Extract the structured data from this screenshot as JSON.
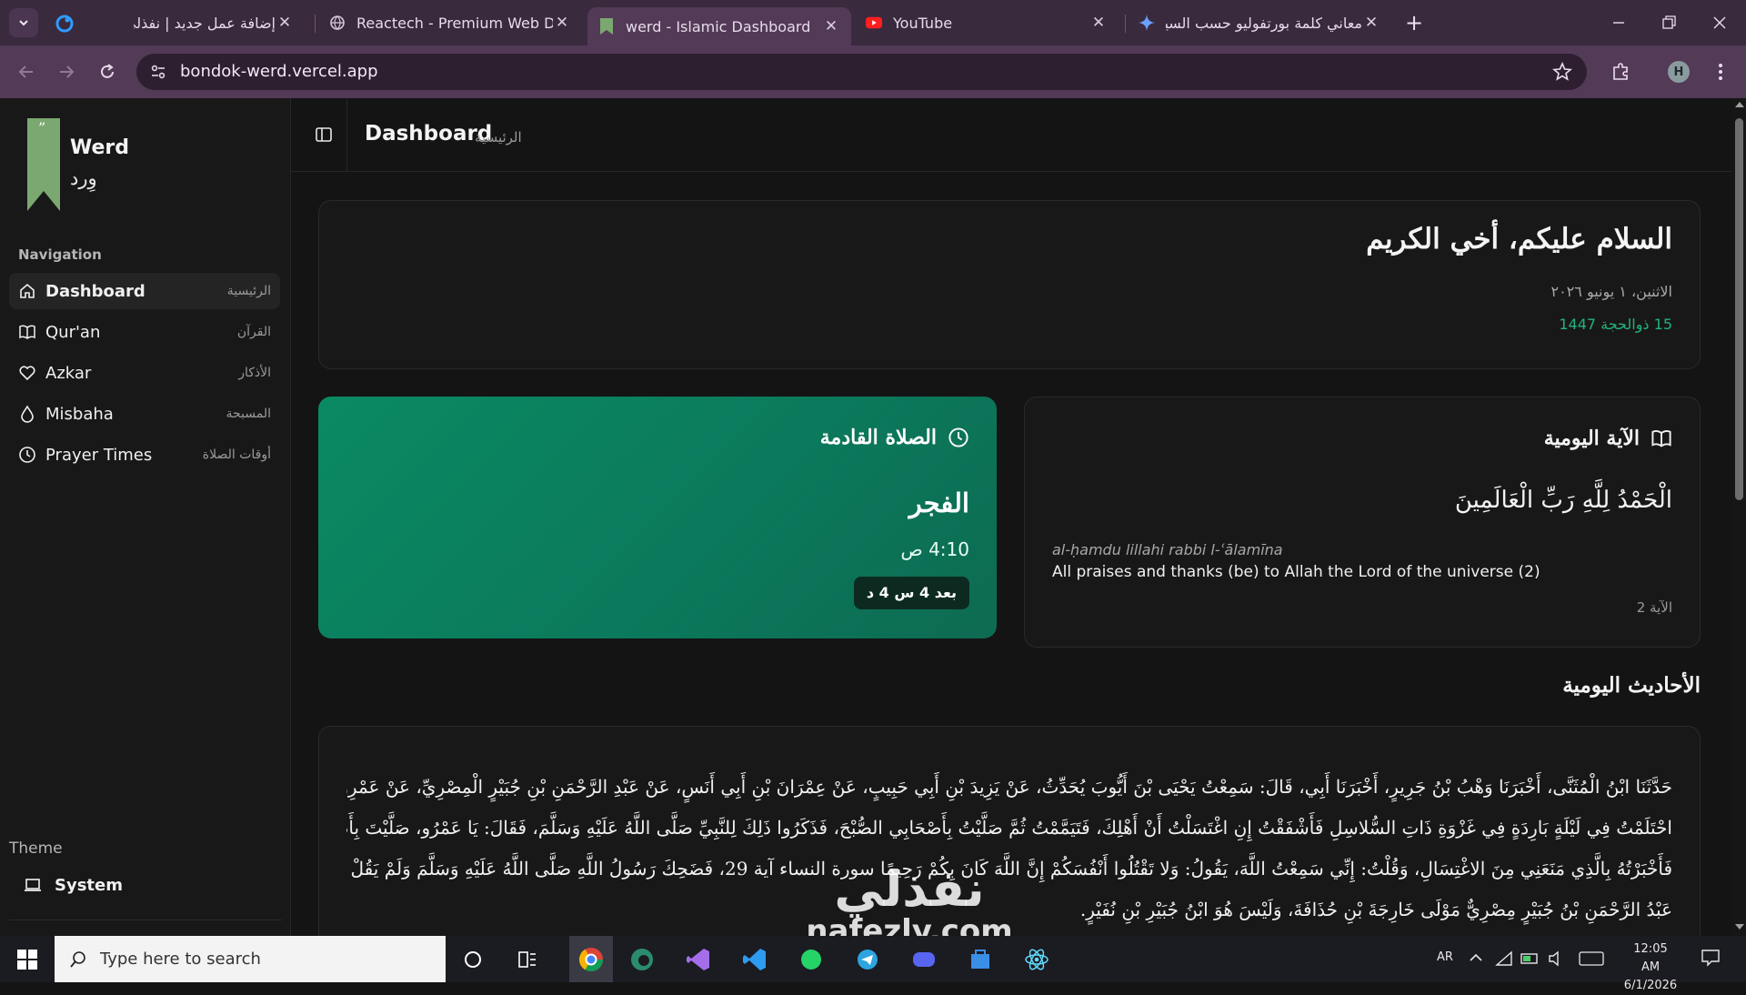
{
  "browser": {
    "tabs": [
      {
        "title": "إضافة عمل جديد | نفذلي"
      },
      {
        "title": "Reactech - Premium Web Devel"
      },
      {
        "title": "werd - Islamic Dashboard"
      },
      {
        "title": "YouTube"
      },
      {
        "title": "معاني كلمة بورتفوليو حسب السيا"
      }
    ],
    "url": "bondok-werd.vercel.app",
    "profile_initial": "H"
  },
  "app": {
    "brand_en": "Werd",
    "brand_ar": "وِرد",
    "nav_heading": "Navigation",
    "nav": [
      {
        "en": "Dashboard",
        "ar": "الرئيسية"
      },
      {
        "en": "Qur'an",
        "ar": "القرآن"
      },
      {
        "en": "Azkar",
        "ar": "الأذكار"
      },
      {
        "en": "Misbaha",
        "ar": "المسبحة"
      },
      {
        "en": "Prayer Times",
        "ar": "أوقات الصلاة"
      }
    ],
    "theme_heading": "Theme",
    "theme_value": "System",
    "header_title": "Dashboard",
    "header_subtitle": "الرئيسية"
  },
  "greeting": {
    "title": "السلام عليكم، أخي الكريم",
    "gregorian": "الاثنين، ١ يونيو ٢٠٢٦",
    "hijri": "15 ذوالحجة 1447"
  },
  "prayer": {
    "heading": "الصلاة القادمة",
    "name": "الفجر",
    "time": "4:10 ص",
    "countdown": "بعد 4 س 4 د"
  },
  "ayah": {
    "heading": "الآية اليومية",
    "arabic": "الْحَمْدُ لِلَّهِ رَبِّ الْعَالَمِينَ",
    "transliteration": "al-ḥamdu lillahi rabbi l-ʿālamīna",
    "translation": "All praises and thanks (be) to Allah the Lord of the universe (2)",
    "number_label": "الآية 2"
  },
  "hadith": {
    "heading": "الأحاديث اليومية",
    "lines": [
      "حَدَّثَنَا ابْنُ الْمُثَنَّى، أَخْبَرَنَا وَهْبُ بْنُ جَرِيرٍ، أَخْبَرَنَا أَبِي، قَالَ: سَمِعْتُ يَحْيَى بْنَ أَيُّوبَ يُحَدِّثُ، عَنْ يَزِيدَ بْنِ أَبِي حَبِيبٍ، عَنْ عِمْرَانَ بْنِ أَبِي أَنَسٍ، عَنْ عَبْدِ الرَّحْمَنِ بْنِ جُبَيْرٍ الْمِصْرِيِّ، عَنْ عَمْرِو بْنِ الْعَاصِ، قَالَ:",
      "احْتَلَمْتُ فِي لَيْلَةٍ بَارِدَةٍ فِي غَزْوَةِ ذَاتِ السُّلاسِلِ فَأَشْفَقْتُ إِنِ اغْتَسَلْتُ أَنْ أَهْلِكَ، فَتَيَمَّمْتُ ثُمَّ صَلَّيْتُ بِأَصْحَابِي الصُّبْحَ، فَذَكَرُوا ذَلِكَ لِلنَّبِيِّ صَلَّى اللَّهُ عَلَيْهِ وَسَلَّمَ، فَقَالَ: يَا عَمْرُو، صَلَّيْتَ بِأَصْحَابِكَ وَأَنْتَ جُنُبٌ ؟",
      "فَأَخْبَرْتُهُ بِالَّذِي مَنَعَنِي مِنَ الاغْتِسَالِ، وَقُلْتُ: إِنِّي سَمِعْتُ اللَّهَ، يَقُولُ: وَلا تَقْتُلُوا أَنْفُسَكُمْ إِنَّ اللَّهَ كَانَ بِكُمْ رَحِيمًا سورة النساء آية 29، فَضَحِكَ رَسُولُ اللَّهِ صَلَّى اللَّهُ عَلَيْهِ وَسَلَّمَ وَلَمْ يَقُلْ شَيْئًا ، قَالَ أَبُو دَاوُد:",
      "عَبْدُ الرَّحْمَنِ بْنُ جُبَيْرٍ مِصْرِيٌّ مَوْلَى خَارِجَةَ بْنِ حُذَافَةَ، وَلَيْسَ هُوَ ابْنُ جُبَيْرِ بْنِ نُفَيْرٍ."
    ]
  },
  "watermark": "nafezly.com",
  "watermark_ar": "نفذلي",
  "taskbar": {
    "search_placeholder": "Type here to search",
    "lang": "AR",
    "time": "12:05 AM",
    "date": "6/1/2026"
  },
  "colors": {
    "accent_green": "#0a8a62",
    "hijri_green": "#23b37a"
  }
}
